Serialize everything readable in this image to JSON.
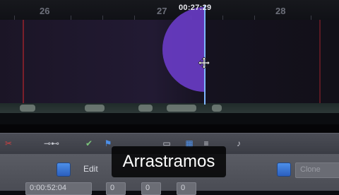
{
  "ruler": {
    "labels": [
      "26",
      "27",
      "28"
    ]
  },
  "playhead": {
    "timecode": "00:27:29"
  },
  "toolbar": {
    "edit_label": "Edit",
    "right_field_placeholder": "Clone"
  },
  "bottom": {
    "timecode_field": "0:00:52:04",
    "field_a": "0",
    "field_b": "0",
    "field_c": "0"
  },
  "caption": {
    "text": "Arrastramos"
  },
  "colors": {
    "accent_blue": "#3b78d8",
    "drag_circle": "#6a3cc8",
    "playhead": "#7eb6ff"
  },
  "icons": [
    "scissors-icon",
    "link-icon",
    "check-icon",
    "folder-icon",
    "grid-icon",
    "audio-icon"
  ]
}
